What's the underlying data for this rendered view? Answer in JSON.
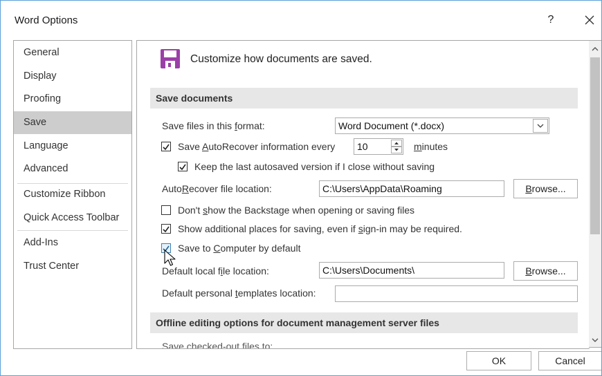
{
  "dialog": {
    "title": "Word Options",
    "help_label": "?",
    "close_icon": "close-icon"
  },
  "sidebar": {
    "items": [
      {
        "label": "General"
      },
      {
        "label": "Display"
      },
      {
        "label": "Proofing"
      },
      {
        "label": "Save",
        "selected": true
      },
      {
        "label": "Language"
      },
      {
        "label": "Advanced"
      },
      {
        "label": "Customize Ribbon"
      },
      {
        "label": "Quick Access Toolbar"
      },
      {
        "label": "Add-Ins"
      },
      {
        "label": "Trust Center"
      }
    ]
  },
  "content": {
    "header_icon": "save-floppy-icon",
    "header_text": "Customize how documents are saved.",
    "section_save": "Save documents",
    "format_label_pre": "Save files in this ",
    "format_label_u": "f",
    "format_label_post": "ormat:",
    "format_value": "Word Document (*.docx)",
    "autorecover": {
      "label_pre": "Save ",
      "label_u": "A",
      "label_post": "utoRecover information every",
      "checked": true,
      "minutes_value": "10",
      "minutes_u": "m",
      "minutes_post": "inutes"
    },
    "keep_last": {
      "label": "Keep the last autosaved version if I close without saving",
      "checked": true
    },
    "autorecover_location": {
      "label_pre": "Auto",
      "label_u": "R",
      "label_post": "ecover file location:",
      "value": "C:\\Users\\AppData\\Roaming",
      "browse_pre": "",
      "browse_u": "B",
      "browse_post": "rowse..."
    },
    "dont_show_backstage": {
      "label_pre": "Don't ",
      "label_u": "s",
      "label_post": "how the Backstage when opening or saving files",
      "checked": false
    },
    "show_additional_places": {
      "label_pre": "Show additional places for saving, even if ",
      "label_u": "s",
      "label_post": "ign-in may be required.",
      "checked": true
    },
    "save_to_computer": {
      "label_pre": "Save to ",
      "label_u": "C",
      "label_post": "omputer by default",
      "checked": true
    },
    "default_local": {
      "label_pre": "Default local f",
      "label_u": "i",
      "label_post": "le location:",
      "value": "C:\\Users\\Documents\\",
      "browse_u": "B",
      "browse_post": "rowse..."
    },
    "default_templates": {
      "label_pre": "Default personal ",
      "label_u": "t",
      "label_post": "emplates location:",
      "value": ""
    },
    "section_offline": "Offline editing options for document management server files",
    "partial_row": "Save checked-out files to:"
  },
  "footer": {
    "ok_label": "OK",
    "cancel_label": "Cancel"
  },
  "colors": {
    "selected_nav": "#cdcdcd",
    "section_bg": "#e7e7e7",
    "accent_icon": "#9b3fa8",
    "border": "#a6a6a6",
    "window_border": "#5aa0d8"
  }
}
